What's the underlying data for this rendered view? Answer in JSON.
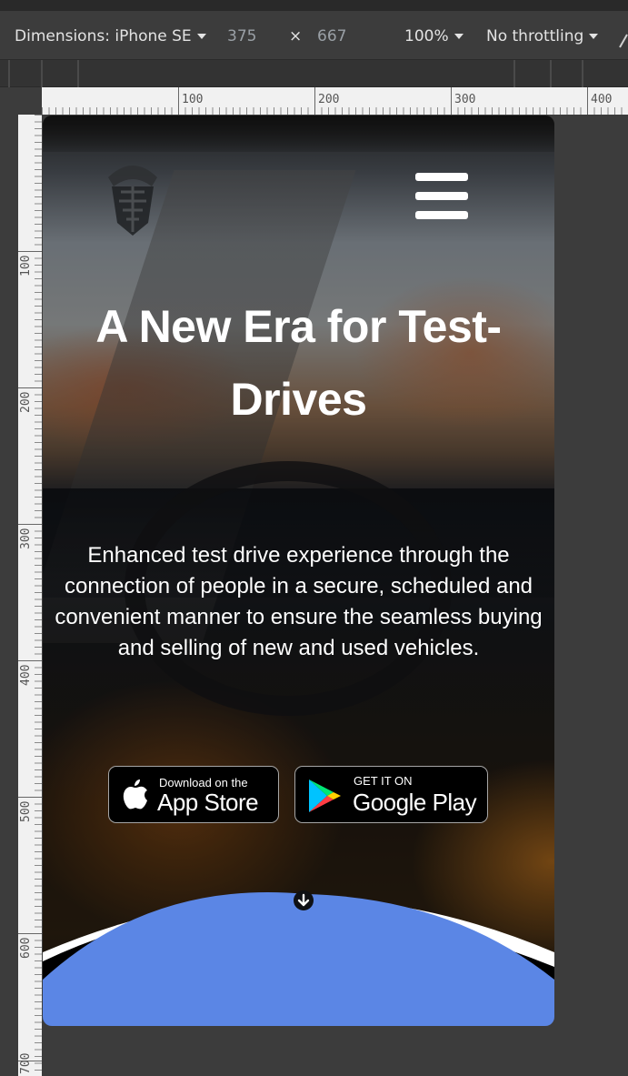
{
  "devtools": {
    "dimensions_label": "Dimensions: iPhone SE",
    "width": "375",
    "times": "×",
    "height": "667",
    "zoom": "100%",
    "throttling": "No throttling"
  },
  "rulers": {
    "horizontal": [
      "100",
      "200",
      "300",
      "400"
    ],
    "vertical": [
      "100",
      "200",
      "300",
      "400",
      "500",
      "600",
      "700"
    ]
  },
  "hero": {
    "headline_line1": "A New Era for Test-",
    "headline_line2": "Drives",
    "description": "Enhanced test drive experience through the connection of people in a secure, scheduled and convenient manner to ensure the seamless buying and selling of new and used vehicles.",
    "app_store": {
      "small": "Download on the",
      "big": "App Store"
    },
    "google_play": {
      "small": "GET IT ON",
      "big": "Google Play"
    }
  },
  "colors": {
    "accent_blue": "#5b86e5",
    "toolbar_bg": "#3c3c3c",
    "text_white": "#ffffff"
  },
  "icons": [
    "logo-icon",
    "hamburger-menu-icon",
    "apple-icon",
    "google-play-icon",
    "arrow-down-icon",
    "caret-down-icon"
  ]
}
